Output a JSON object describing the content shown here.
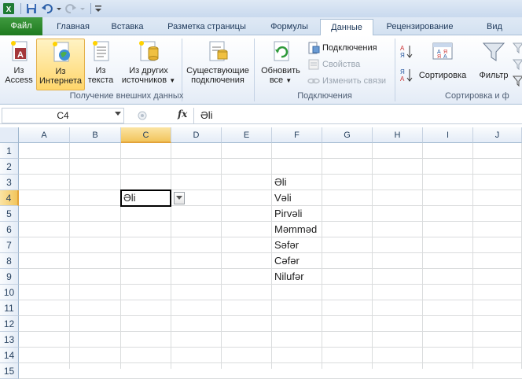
{
  "tabs": [
    {
      "label": "Файл",
      "key": "file"
    },
    {
      "label": "Главная",
      "key": "home"
    },
    {
      "label": "Вставка",
      "key": "insert"
    },
    {
      "label": "Разметка страницы",
      "key": "layout"
    },
    {
      "label": "Формулы",
      "key": "formulas"
    },
    {
      "label": "Данные",
      "key": "data"
    },
    {
      "label": "Рецензирование",
      "key": "review"
    },
    {
      "label": "Вид",
      "key": "view"
    }
  ],
  "ribbon": {
    "get_external": {
      "from_access_1": "Из",
      "from_access_2": "Access",
      "from_web_1": "Из",
      "from_web_2": "Интернета",
      "from_text_1": "Из",
      "from_text_2": "текста",
      "from_other_1": "Из других",
      "from_other_2": "источников",
      "existing_1": "Существующие",
      "existing_2": "подключения",
      "label": "Получение внешних данных"
    },
    "connections": {
      "refresh_1": "Обновить",
      "refresh_2": "все",
      "connections": "Подключения",
      "properties": "Свойства",
      "edit_links": "Изменить связи",
      "label": "Подключения"
    },
    "sort": {
      "sort": "Сортировка",
      "filter": "Фильтр",
      "label": "Сортировка и ф"
    }
  },
  "formula_bar": {
    "name_box": "C4",
    "fx": "fx",
    "value": "Əli"
  },
  "columns": [
    "A",
    "B",
    "C",
    "D",
    "E",
    "F",
    "G",
    "H",
    "I",
    "J"
  ],
  "rows": [
    "1",
    "2",
    "3",
    "4",
    "5",
    "6",
    "7",
    "8",
    "9",
    "10",
    "11",
    "12",
    "13",
    "14",
    "15"
  ],
  "cells": {
    "C4": "Əli",
    "F3": "Əli",
    "F4": "Vəli",
    "F5": "Pirvəli",
    "F6": "Məmməd",
    "F7": "Səfər",
    "F8": "Cəfər",
    "F9": "Nilufər"
  },
  "colors": {
    "file_tab": "#2a8a2a",
    "selection_header": "#f2c55c"
  }
}
